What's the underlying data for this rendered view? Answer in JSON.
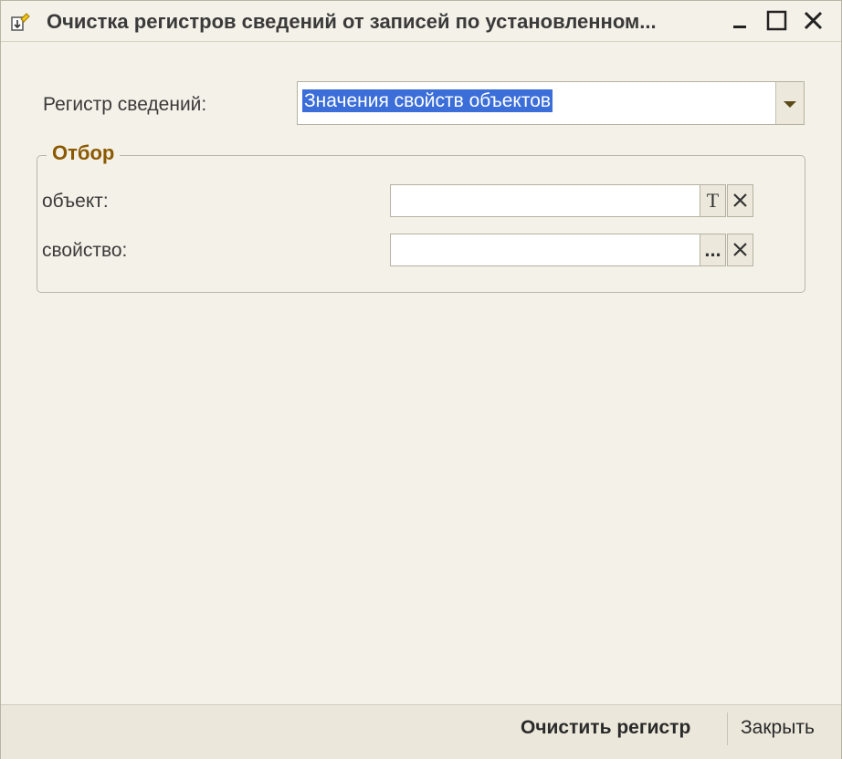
{
  "window": {
    "title": "Очистка регистров сведений от записей по установленном...",
    "icon": "edit-document-icon"
  },
  "form": {
    "register_label": "Регистр сведений:",
    "register_value": "Значения свойств объектов"
  },
  "filter": {
    "title": "Отбор",
    "object_label": "объект:",
    "object_value": "",
    "object_type_button": "T",
    "property_label": "свойство:",
    "property_value": "",
    "property_select_button": "..."
  },
  "footer": {
    "clear_button": "Очистить регистр",
    "close_button": "Закрыть"
  },
  "colors": {
    "background": "#f4f1e8",
    "selection": "#3b6ed8",
    "group_title": "#8b5a00"
  }
}
